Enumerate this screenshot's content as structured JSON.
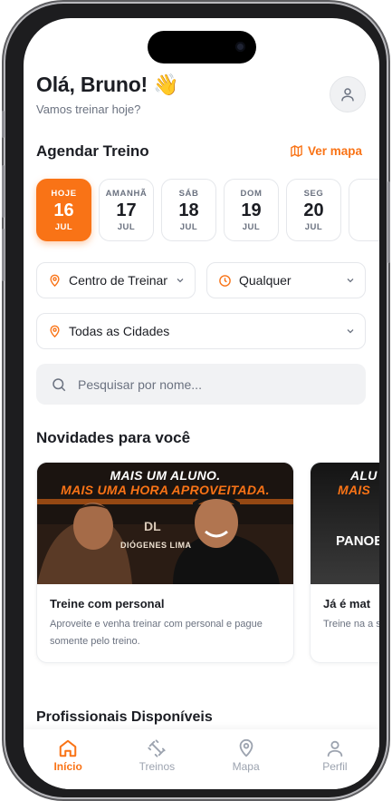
{
  "header": {
    "greeting": "Olá, Bruno!",
    "emoji": "👋",
    "subtitle": "Vamos treinar hoje?"
  },
  "schedule": {
    "title": "Agendar Treino",
    "map_link": "Ver mapa",
    "days": [
      {
        "label": "HOJE",
        "day": "16",
        "month": "JUL",
        "active": true
      },
      {
        "label": "AMANHÃ",
        "day": "17",
        "month": "JUL",
        "active": false
      },
      {
        "label": "SÁB",
        "day": "18",
        "month": "JUL",
        "active": false
      },
      {
        "label": "DOM",
        "day": "19",
        "month": "JUL",
        "active": false
      },
      {
        "label": "SEG",
        "day": "20",
        "month": "JUL",
        "active": false
      }
    ]
  },
  "filters": {
    "gym": "Centro de Treinamento",
    "time": "Qualquer",
    "city": "Todas as Cidades"
  },
  "search": {
    "placeholder": "Pesquisar por nome..."
  },
  "news": {
    "title": "Novidades para você",
    "cards": [
      {
        "banner_top": "MAIS UM ALUNO.",
        "banner_bottom": "MAIS UMA HORA APROVEITADA.",
        "logo": "DIÓGENES LIMA",
        "title": "Treine com personal",
        "desc": "Aproveite e venha treinar com personal e pague somente pelo treino."
      },
      {
        "banner_top": "ALU",
        "banner_bottom": "MAIS",
        "logo": "PANOBI",
        "title": "Já é mat",
        "desc": "Treine na a somente p"
      }
    ]
  },
  "professionals": {
    "title": "Profissionais Disponíveis"
  },
  "tabs": [
    {
      "label": "Início",
      "icon": "home-icon",
      "active": true
    },
    {
      "label": "Treinos",
      "icon": "dumbbell-icon",
      "active": false
    },
    {
      "label": "Mapa",
      "icon": "map-pin-icon",
      "active": false
    },
    {
      "label": "Perfil",
      "icon": "user-icon",
      "active": false
    }
  ],
  "colors": {
    "accent": "#f97316",
    "text": "#1b1d23",
    "muted": "#6b7280"
  }
}
